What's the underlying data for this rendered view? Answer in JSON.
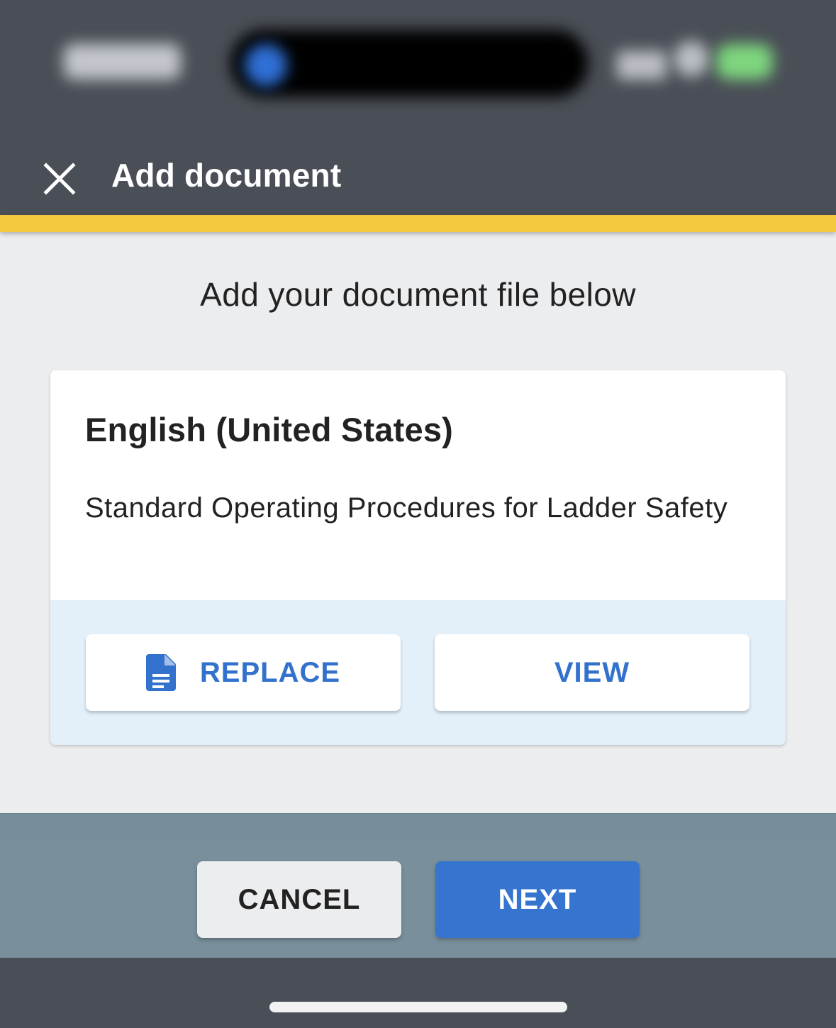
{
  "header": {
    "title": "Add document",
    "close_icon": "close-icon"
  },
  "main": {
    "instruction": "Add your document file below",
    "card": {
      "language": "English (United States)",
      "document_name": "Standard Operating Procedures for Ladder Safety",
      "replace_label": "REPLACE",
      "replace_icon": "document-icon",
      "view_label": "VIEW"
    }
  },
  "footer": {
    "cancel_label": "CANCEL",
    "next_label": "NEXT"
  },
  "colors": {
    "app_bar": "#4a4f57",
    "accent": "#f5c842",
    "primary": "#3575d0",
    "footer": "#79909c"
  }
}
